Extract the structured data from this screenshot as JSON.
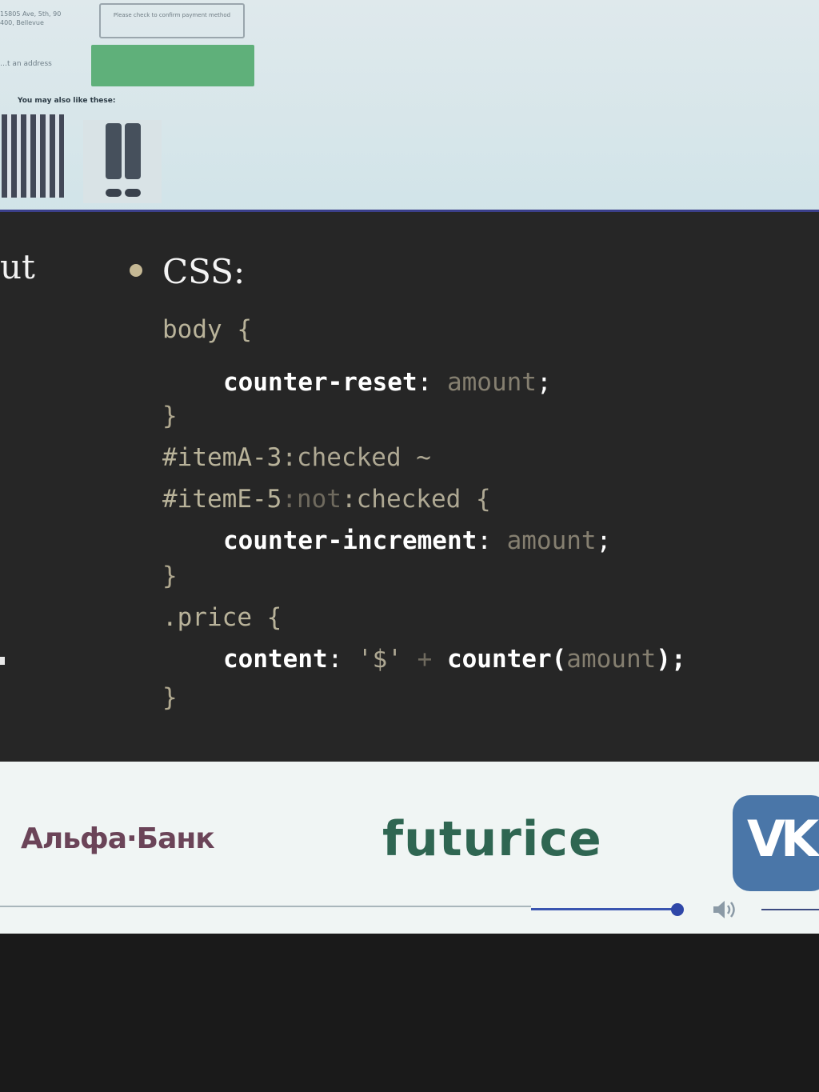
{
  "browser_strip": {
    "address_text": "15805 Ave, 5th, 90 400, Bellevue",
    "address_link": "…t an address",
    "confirm_button": "Please check to confirm payment method",
    "green_button": "",
    "also_like_heading": "You may also like these:"
  },
  "slide": {
    "left_fragment": "ut",
    "heading": "CSS:",
    "code_lines": [
      [
        {
          "t": "body {",
          "c": "c-sel"
        }
      ],
      [
        {
          "t": "counter-reset",
          "c": "c-prop"
        },
        {
          "t": ": ",
          "c": "c-punct"
        },
        {
          "t": "amount",
          "c": "c-val"
        },
        {
          "t": ";",
          "c": "c-punct"
        }
      ],
      [
        {
          "t": "}",
          "c": "c-brace"
        }
      ],
      [
        {
          "t": "#itemA-3",
          "c": "c-sel"
        },
        {
          "t": ":checked ~",
          "c": "c-pseudo"
        }
      ],
      [
        {
          "t": "#itemE-5",
          "c": "c-sel"
        },
        {
          "t": ":not",
          "c": "c-dim"
        },
        {
          "t": ":checked {",
          "c": "c-pseudo"
        }
      ],
      [
        {
          "t": "counter-increment",
          "c": "c-prop"
        },
        {
          "t": ": ",
          "c": "c-punct"
        },
        {
          "t": "amount",
          "c": "c-val"
        },
        {
          "t": ";",
          "c": "c-punct"
        }
      ],
      [
        {
          "t": "}",
          "c": "c-brace"
        }
      ],
      [
        {
          "t": ".price {",
          "c": "c-sel"
        }
      ],
      [
        {
          "t": "content",
          "c": "c-prop"
        },
        {
          "t": ": ",
          "c": "c-punct"
        },
        {
          "t": "'$'",
          "c": "c-pseudo"
        },
        {
          "t": " + ",
          "c": "c-dim"
        },
        {
          "t": "counter(",
          "c": "c-prop"
        },
        {
          "t": "amount",
          "c": "c-val"
        },
        {
          "t": ");",
          "c": "c-prop"
        }
      ],
      [
        {
          "t": "}",
          "c": "c-brace"
        }
      ]
    ]
  },
  "sponsors": {
    "alfa_bank": "Альфа·Банк",
    "futurice": "futurice",
    "vk": "VK"
  },
  "player": {
    "progress_fraction": 0.83
  },
  "colors": {
    "slide_bg": "#262626",
    "progress_accent": "#2f47a8",
    "vk_blue": "#4a76a8",
    "futurice_green": "#2f6652",
    "alfa_color": "#6b4458"
  }
}
